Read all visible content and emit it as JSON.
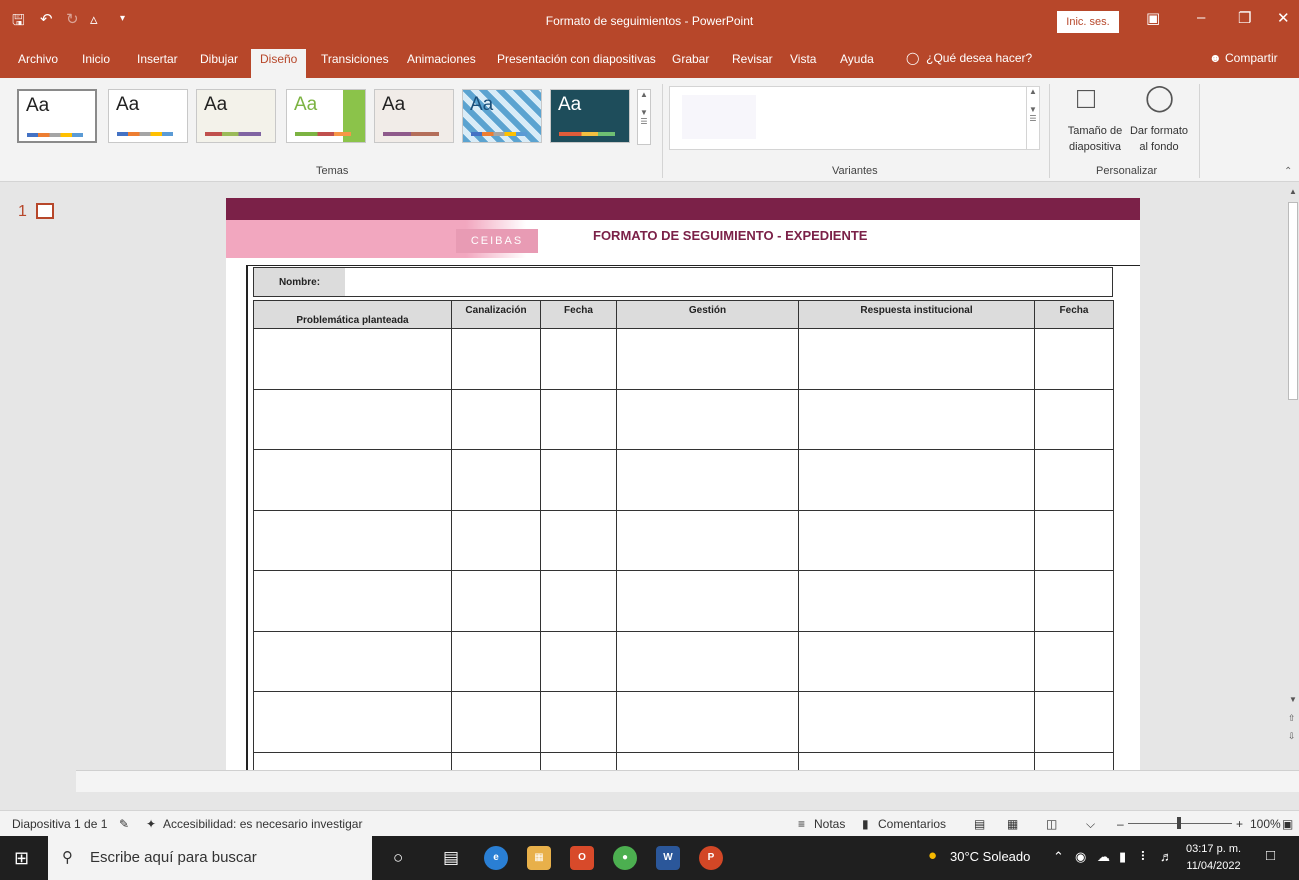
{
  "window": {
    "title": "Formato de seguimientos  -  PowerPoint",
    "signin": "Inic. ses."
  },
  "tabs": [
    "Archivo",
    "Inicio",
    "Insertar",
    "Dibujar",
    "Diseño",
    "Transiciones",
    "Animaciones",
    "Presentación con diapositivas",
    "Grabar",
    "Revisar",
    "Vista",
    "Ayuda"
  ],
  "active_tab": "Diseño",
  "tell_me": "¿Qué desea hacer?",
  "share": "Compartir",
  "ribbon": {
    "themes_label": "Temas",
    "variants_label": "Variantes",
    "customize_label": "Personalizar",
    "slide_size_label": "Tamaño de diapositiva",
    "format_bg_label": "Dar formato al fondo",
    "theme_sample": "Aa"
  },
  "thumbnail": {
    "number": "1"
  },
  "slide": {
    "logo": "CEIBAS",
    "title": "FORMATO DE SEGUIMIENTO - EXPEDIENTE",
    "name_label": "Nombre:",
    "columns": [
      "Problemática planteada",
      "Canalización",
      "Fecha",
      "Gestión",
      "Respuesta institucional",
      "Fecha"
    ]
  },
  "status": {
    "slide_info": "Diapositiva 1 de 1",
    "accessibility": "Accesibilidad: es necesario investigar",
    "notes": "Notas",
    "comments": "Comentarios",
    "zoom": "100%"
  },
  "taskbar": {
    "search_placeholder": "Escribe aquí para buscar",
    "weather": "30°C  Soleado",
    "time": "03:17 p. m.",
    "date": "11/04/2022"
  },
  "colors": {
    "accent": "#b7472a",
    "slide_bar": "#7b2148",
    "pink": "#f2a7bf"
  }
}
